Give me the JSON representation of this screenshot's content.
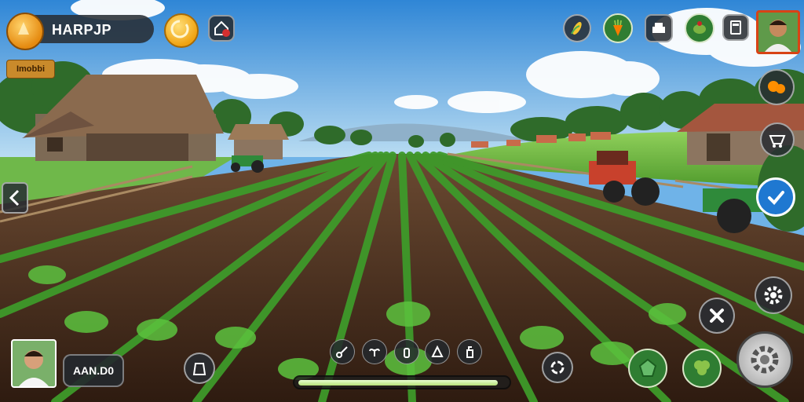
{
  "player": {
    "name": "HARPJP",
    "mode_tag": "Imobbi"
  },
  "bottom_panel": {
    "label": "AAN.D0"
  },
  "progress": {
    "fraction": 0.97
  },
  "top_bar": {
    "icons": [
      "corn-icon",
      "carrot-icon",
      "shop-icon",
      "turtle-icon",
      "calculator-icon"
    ]
  },
  "colors": {
    "accent_blue": "#1f78d1",
    "panel_dark": "#2a2f35",
    "field_green": "#3f9a2f",
    "soil": "#4a2e1c"
  },
  "tools": [
    "scissors-icon",
    "seed-icon",
    "bottle-icon",
    "fertilizer-icon",
    "spray-icon"
  ]
}
